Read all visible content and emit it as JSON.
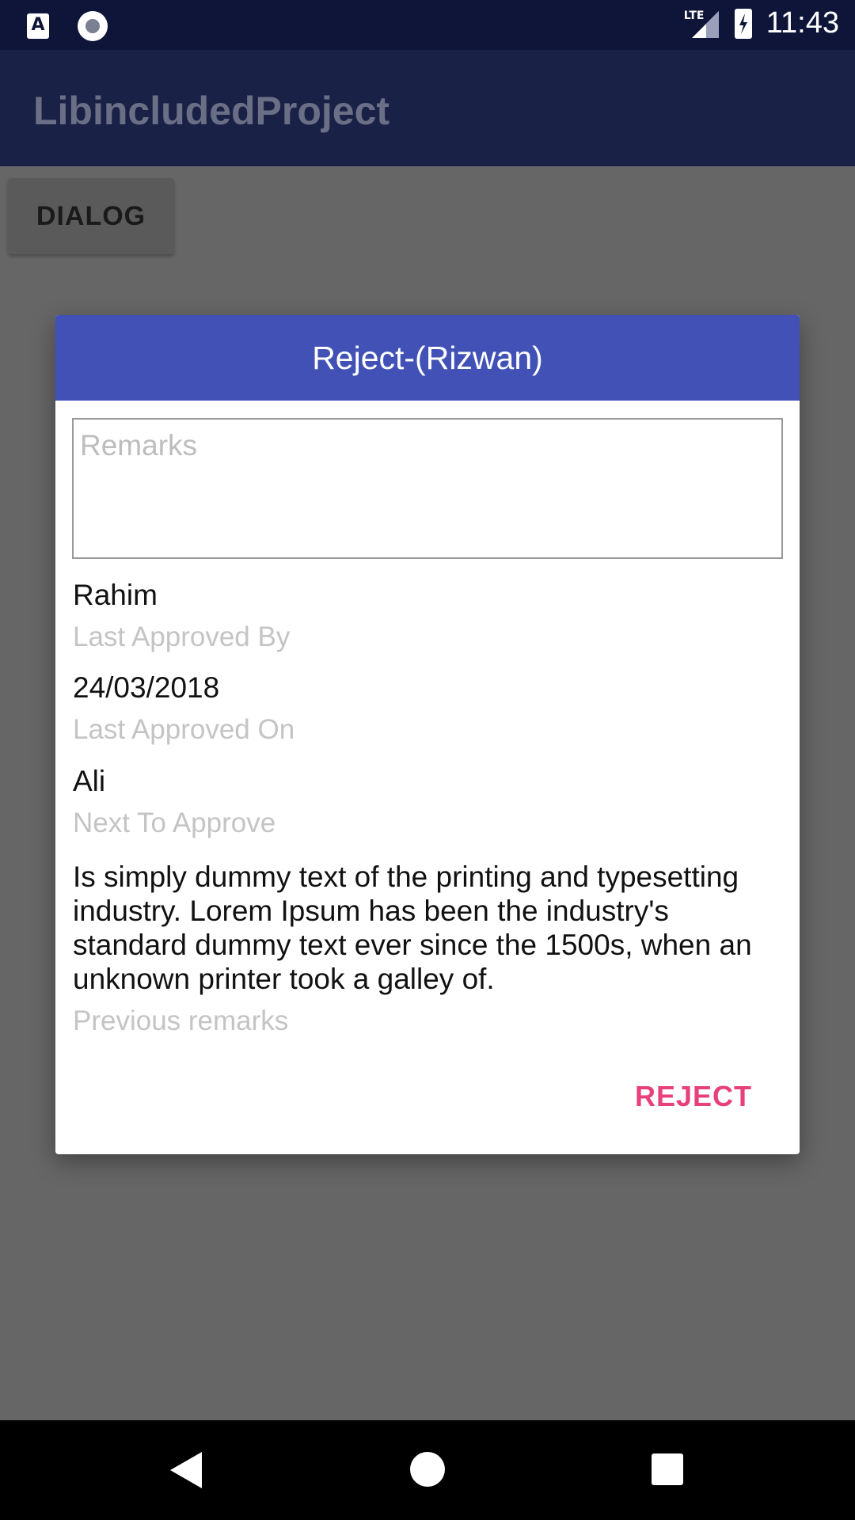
{
  "status_bar": {
    "time": "11:43",
    "network": "LTE",
    "icons": [
      "a-notification-icon",
      "circle-notification-icon",
      "lte-signal-icon",
      "battery-charging-icon"
    ]
  },
  "app_bar": {
    "title": "LibincludedProject"
  },
  "main": {
    "dialog_button_label": "DIALOG"
  },
  "dialog": {
    "title": "Reject-(Rizwan)",
    "remarks_placeholder": "Remarks",
    "remarks_value": "",
    "fields": [
      {
        "value": "Rahim",
        "label": "Last Approved By"
      },
      {
        "value": "24/03/2018",
        "label": "Last Approved On"
      },
      {
        "value": "Ali",
        "label": "Next To Approve"
      },
      {
        "value": "Is simply dummy text of the printing and typesetting industry. Lorem Ipsum has been the industry's standard dummy text ever since the 1500s, when an unknown printer took a galley of.",
        "label": "Previous remarks"
      }
    ],
    "reject_label": "REJECT",
    "header_color": "#4151B5",
    "accent_color": "#E8407C"
  },
  "nav_bar": {
    "icons": [
      "back-icon",
      "home-icon",
      "recents-icon"
    ]
  }
}
